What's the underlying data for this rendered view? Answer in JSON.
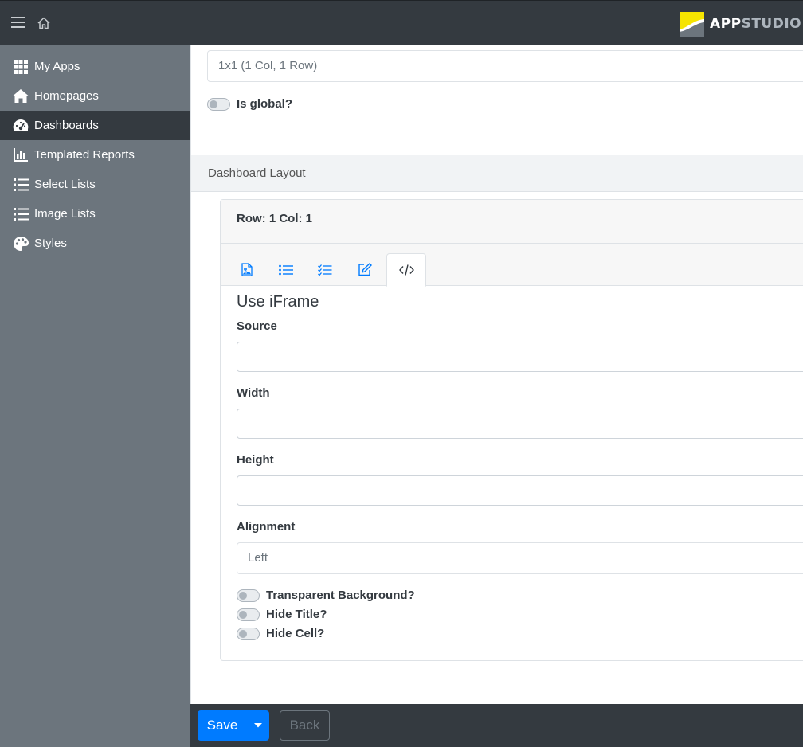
{
  "topbar": {
    "menu_icon": "hamburger-icon",
    "home_icon": "home-outline-icon",
    "brand": {
      "part1": "APP",
      "part2": "STUDIO"
    }
  },
  "sidebar": {
    "items": [
      {
        "label": "My Apps",
        "icon": "grid-icon",
        "active": false
      },
      {
        "label": "Homepages",
        "icon": "home-icon",
        "active": false
      },
      {
        "label": "Dashboards",
        "icon": "gauge-icon",
        "active": true
      },
      {
        "label": "Templated Reports",
        "icon": "bar-chart-icon",
        "active": false
      },
      {
        "label": "Select Lists",
        "icon": "list-icon",
        "active": false
      },
      {
        "label": "Image Lists",
        "icon": "list-icon",
        "active": false
      },
      {
        "label": "Styles",
        "icon": "palette-icon",
        "active": false
      }
    ]
  },
  "main": {
    "layout_value": "1x1 (1 Col, 1 Row)",
    "is_global_label": "Is global?",
    "is_global": false,
    "layout_header": "Dashboard Layout",
    "cell": {
      "title": "Row: 1 Col: 1",
      "tabs": [
        {
          "icon": "file-image-icon",
          "active": false
        },
        {
          "icon": "list-icon",
          "active": false
        },
        {
          "icon": "checklist-icon",
          "active": false
        },
        {
          "icon": "edit-icon",
          "active": false
        },
        {
          "icon": "code-icon",
          "active": true
        }
      ],
      "section_title": "Use iFrame",
      "source_label": "Source",
      "source_value": "",
      "width_label": "Width",
      "width_value": "",
      "height_label": "Height",
      "height_value": "",
      "alignment_label": "Alignment",
      "alignment_value": "Left",
      "toggles": [
        {
          "label": "Transparent Background?",
          "on": false
        },
        {
          "label": "Hide Title?",
          "on": false
        },
        {
          "label": "Hide Cell?",
          "on": false
        }
      ]
    }
  },
  "footer": {
    "save_label": "Save",
    "back_label": "Back"
  },
  "colors": {
    "topbar": "#343a40",
    "sidebar": "#6c757d",
    "primary": "#007bff",
    "brand_yellow": "#f5e400"
  }
}
